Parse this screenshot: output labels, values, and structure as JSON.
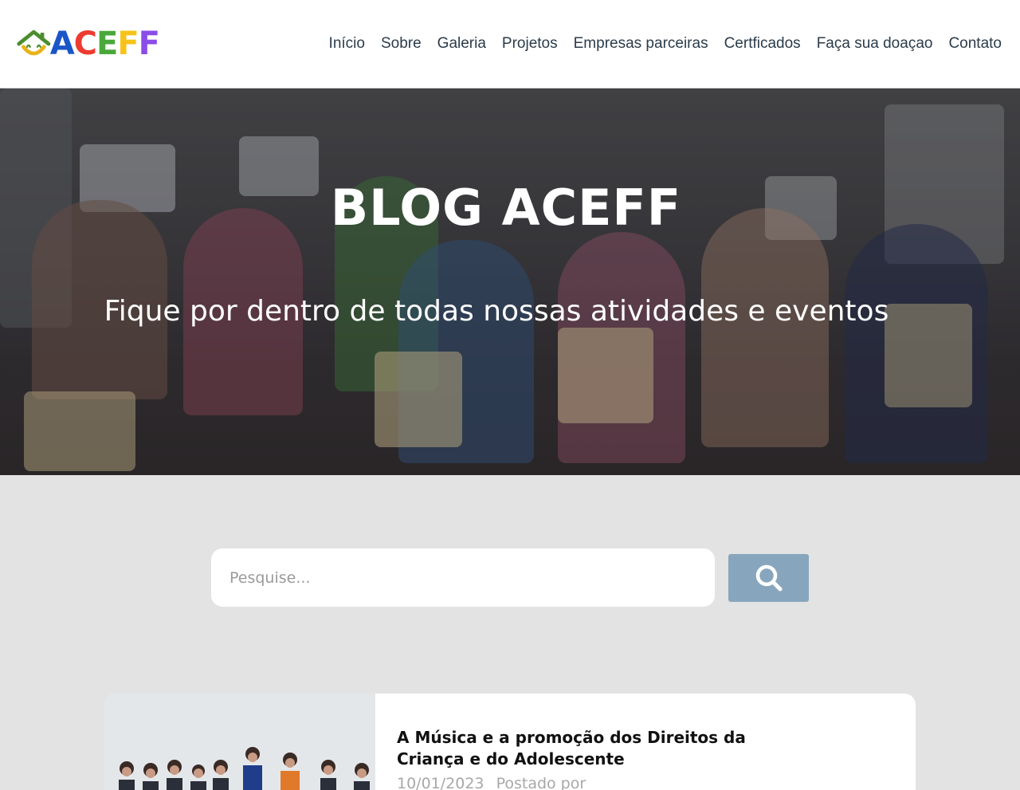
{
  "logo": {
    "letters": [
      {
        "char": "A",
        "color": "#1a56c9"
      },
      {
        "char": "C",
        "color": "#ee3b2f"
      },
      {
        "char": "E",
        "color": "#4aa83a"
      },
      {
        "char": "F",
        "color": "#f7c31a"
      },
      {
        "char": "F",
        "color": "#8a4de8"
      }
    ],
    "house_color": "#4b8d2e",
    "smile_color": "#e8b21a"
  },
  "nav": {
    "items": [
      {
        "label": "Início"
      },
      {
        "label": "Sobre"
      },
      {
        "label": "Galeria"
      },
      {
        "label": "Projetos"
      },
      {
        "label": "Empresas parceiras"
      },
      {
        "label": "Certficados"
      },
      {
        "label": "Faça sua doaçao"
      },
      {
        "label": "Contato"
      }
    ]
  },
  "hero": {
    "title": "BLOG ACEFF",
    "subtitle": "Fique por dentro de todas nossas atividades e eventos"
  },
  "search": {
    "placeholder": "Pesquise...",
    "value": "",
    "button_icon": "search-icon",
    "button_color": "#87a6bd"
  },
  "posts": [
    {
      "title": "A Música e a promoção dos Direitos da Criança e do Adolescente",
      "date": "10/01/2023",
      "posted_by_label": "Postado por"
    }
  ]
}
